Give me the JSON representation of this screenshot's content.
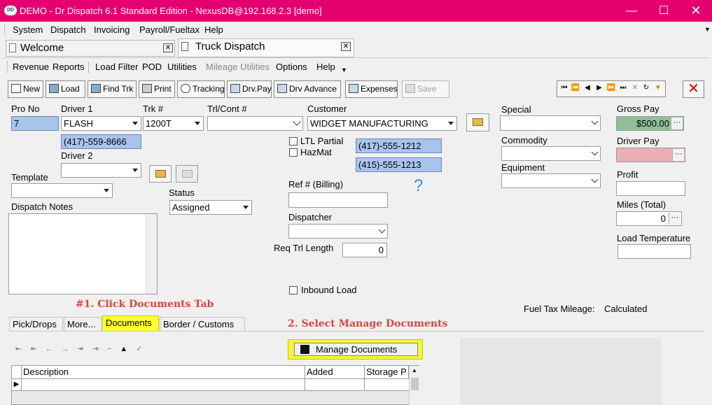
{
  "window": {
    "title": "DEMO - Dr Dispatch 6.1 Standard Edition - NexusDB@192.168.2.3 [demo]",
    "app_icon_text": "DD"
  },
  "menu": [
    "System",
    "Dispatch",
    "Invoicing",
    "Payroll/Fueltax",
    "Help"
  ],
  "doc_tabs": [
    {
      "label": "Welcome"
    },
    {
      "label": "Truck Dispatch"
    }
  ],
  "submenu": [
    "Revenue",
    "Reports",
    "Load Filter",
    "POD",
    "Utilities",
    "Mileage Utilities",
    "Options",
    "Help"
  ],
  "toolbar": {
    "new": "New",
    "load": "Load",
    "find_trk": "Find Trk",
    "print": "Print",
    "tracking": "Tracking",
    "drv_pay": "Drv.Pay",
    "drv_advance": "Drv Advance",
    "expenses": "Expenses",
    "save": "Save"
  },
  "form": {
    "pro_no_label": "Pro No",
    "pro_no": "7",
    "driver1_label": "Driver 1",
    "driver1": "FLASH",
    "driver1_phone": "(417)-559-8666",
    "driver2_label": "Driver 2",
    "trk_label": "Trk #",
    "trk": "1200T",
    "trl_label": "Trl/Cont #",
    "customer_label": "Customer",
    "customer": "WIDGET MANUFACTURING",
    "ltl_partial": "LTL Partial",
    "hazmat": "HazMat",
    "phone1": "(417)-555-1212",
    "phone2": "(415)-555-1213",
    "help_glyph": "?",
    "template_label": "Template",
    "status_label": "Status",
    "status": "Assigned",
    "dispatch_notes_label": "Dispatch Notes",
    "ref_label": "Ref # (Billing)",
    "dispatcher_label": "Dispatcher",
    "req_trl_label": "Req Trl Length",
    "req_trl": "0",
    "inbound_load": "Inbound Load",
    "special_label": "Special",
    "commodity_label": "Commodity",
    "equipment_label": "Equipment",
    "gross_pay_label": "Gross Pay",
    "gross_pay": "$500.00",
    "driver_pay_label": "Driver Pay",
    "profit_label": "Profit",
    "miles_label": "Miles (Total)",
    "miles": "0",
    "load_temp_label": "Load Temperature",
    "fuel_tax_label": "Fuel Tax Mileage:",
    "fuel_tax_value": "Calculated",
    "ellipsis": "···"
  },
  "annotations": {
    "step1": "#1. Click Documents Tab",
    "step2": "2. Select Manage Documents"
  },
  "bottom_tabs": [
    "Pick/Drops",
    "More...",
    "Documents",
    "Border / Customs"
  ],
  "manage_documents": "Manage Documents",
  "grid_columns": [
    "Description",
    "Added",
    "Storage P"
  ],
  "colors": {
    "title_bar": "#e4006e",
    "highlight": "#ffff33",
    "annotation": "#d9453d"
  }
}
